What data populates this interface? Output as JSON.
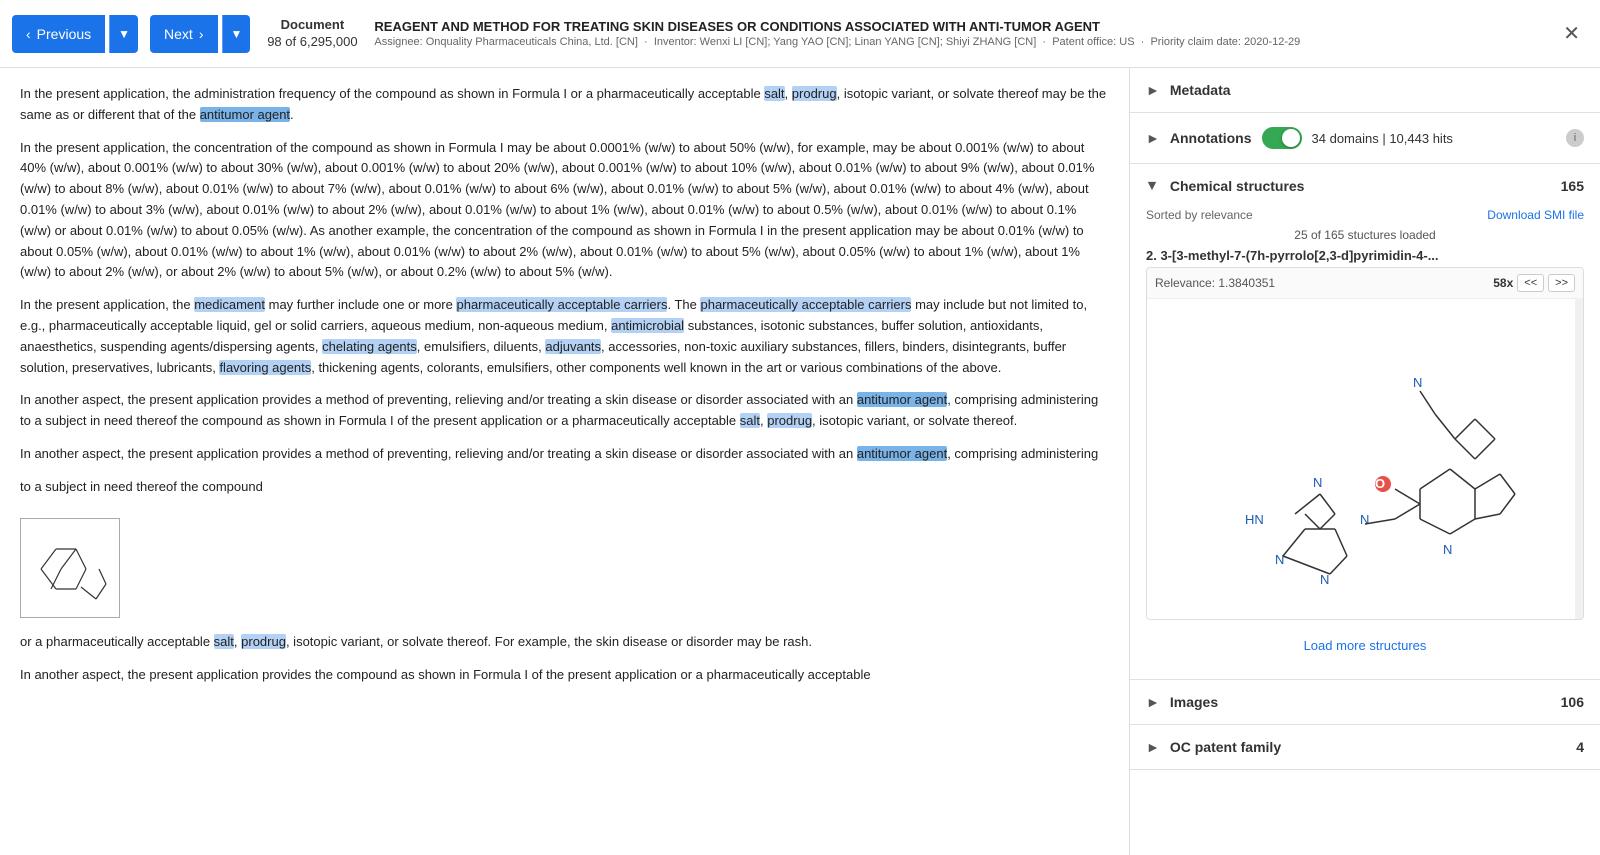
{
  "header": {
    "prev_label": "Previous",
    "next_label": "Next",
    "doc_label": "Document",
    "doc_count": "98 of 6,295,000",
    "patent_title": "REAGENT AND METHOD FOR TREATING SKIN DISEASES OR CONDITIONS ASSOCIATED WITH ANTI-TUMOR AGENT",
    "assignee": "Assignee: Onquality Pharmaceuticals China, Ltd. [CN]",
    "inventor": "Inventor: Wenxi LI [CN]; Yang YAO [CN]; Linan YANG [CN]; Shiyi ZHANG [CN]",
    "patent_office": "Patent office: US",
    "priority_date": "Priority claim date: 2020-12-29"
  },
  "sidebar": {
    "metadata_label": "Metadata",
    "annotations_label": "Annotations",
    "annotations_stats": "34 domains | 10,443 hits",
    "chem_structures_label": "Chemical structures",
    "chem_count": 165,
    "sort_label": "Sorted by relevance",
    "download_label": "Download SMI file",
    "structures_loaded": "25 of 165 stuctures loaded",
    "structure_title": "2. 3-[3-methyl-7-(7h-pyrrolo[2,3-d]pyrimidin-4-...",
    "relevance": "Relevance: 1.3840351",
    "zoom": "58x",
    "nav_prev": "<<",
    "nav_next": ">>",
    "load_more": "Load more structures",
    "images_label": "Images",
    "images_count": 106,
    "oc_patent_label": "OC patent family",
    "oc_patent_count": 4
  },
  "document": {
    "paragraphs": [
      "In the present application, the administration frequency of the compound as shown in Formula I or a pharmaceutically acceptable salt, prodrug, isotopic variant, or solvate thereof may be the same as or different that of the antitumor agent.",
      "In the present application, the concentration of the compound as shown in Formula I may be about 0.0001% (w/w) to about 50% (w/w), for example, may be about 0.001% (w/w) to about 40% (w/w), about 0.001% (w/w) to about 30% (w/w), about 0.001% (w/w) to about 20% (w/w), about 0.001% (w/w) to about 10% (w/w), about 0.01% (w/w) to about 9% (w/w), about 0.01% (w/w) to about 8% (w/w), about 0.01% (w/w) to about 7% (w/w), about 0.01% (w/w) to about 6% (w/w), about 0.01% (w/w) to about 5% (w/w), about 0.01% (w/w) to about 4% (w/w), about 0.01% (w/w) to about 3% (w/w), about 0.01% (w/w) to about 2% (w/w), about 0.01% (w/w) to about 1% (w/w), about 0.01% (w/w) to about 0.5% (w/w), about 0.01% (w/w) to about 0.1% (w/w) or about 0.01% (w/w) to about 0.05% (w/w). As another example, the concentration of the compound as shown in Formula I in the present application may be about 0.01% (w/w) to about 0.05% (w/w), about 0.01% (w/w) to about 1% (w/w), about 0.01% (w/w) to about 2% (w/w), about 0.01% (w/w) to about 5% (w/w), about 0.05% (w/w) to about 1% (w/w), about 1% (w/w) to about 2% (w/w), or about 2% (w/w) to about 5% (w/w), or about 0.2% (w/w) to about 5% (w/w).",
      "In the present application, the medicament may further include one or more pharmaceutically acceptable carriers. The pharmaceutically acceptable carriers may include but not limited to, e.g., pharmaceutically acceptable liquid, gel or solid carriers, aqueous medium, non-aqueous medium, antimicrobial substances, isotonic substances, buffer solution, antioxidants, anaesthetics, suspending agents/dispersing agents, chelating agents, emulsifiers, diluents, adjuvants, accessories, non-toxic auxiliary substances, fillers, binders, disintegrants, buffer solution, preservatives, lubricants, flavoring agents, thickening agents, colorants, emulsifiers, other components well known in the art or various combinations of the above.",
      "In another aspect, the present application provides a method of preventing, relieving and/or treating a skin disease or disorder associated with an antitumor agent, comprising administering to a subject in need thereof the compound as shown in Formula I of the present application or a pharmaceutically acceptable salt, prodrug, isotopic variant, or solvate thereof.",
      "In another aspect, the present application provides a method of preventing, relieving and/or treating a skin disease or disorder associated with an antitumor agent, comprising administering",
      "to a subject in need thereof the compound",
      "or a pharmaceutically acceptable salt, prodrug, isotopic variant, or solvate thereof. For example, the skin disease or disorder may be rash.",
      "In another aspect, the present application provides the compound as shown in Formula I of the present application or a pharmaceutically acceptable"
    ]
  }
}
